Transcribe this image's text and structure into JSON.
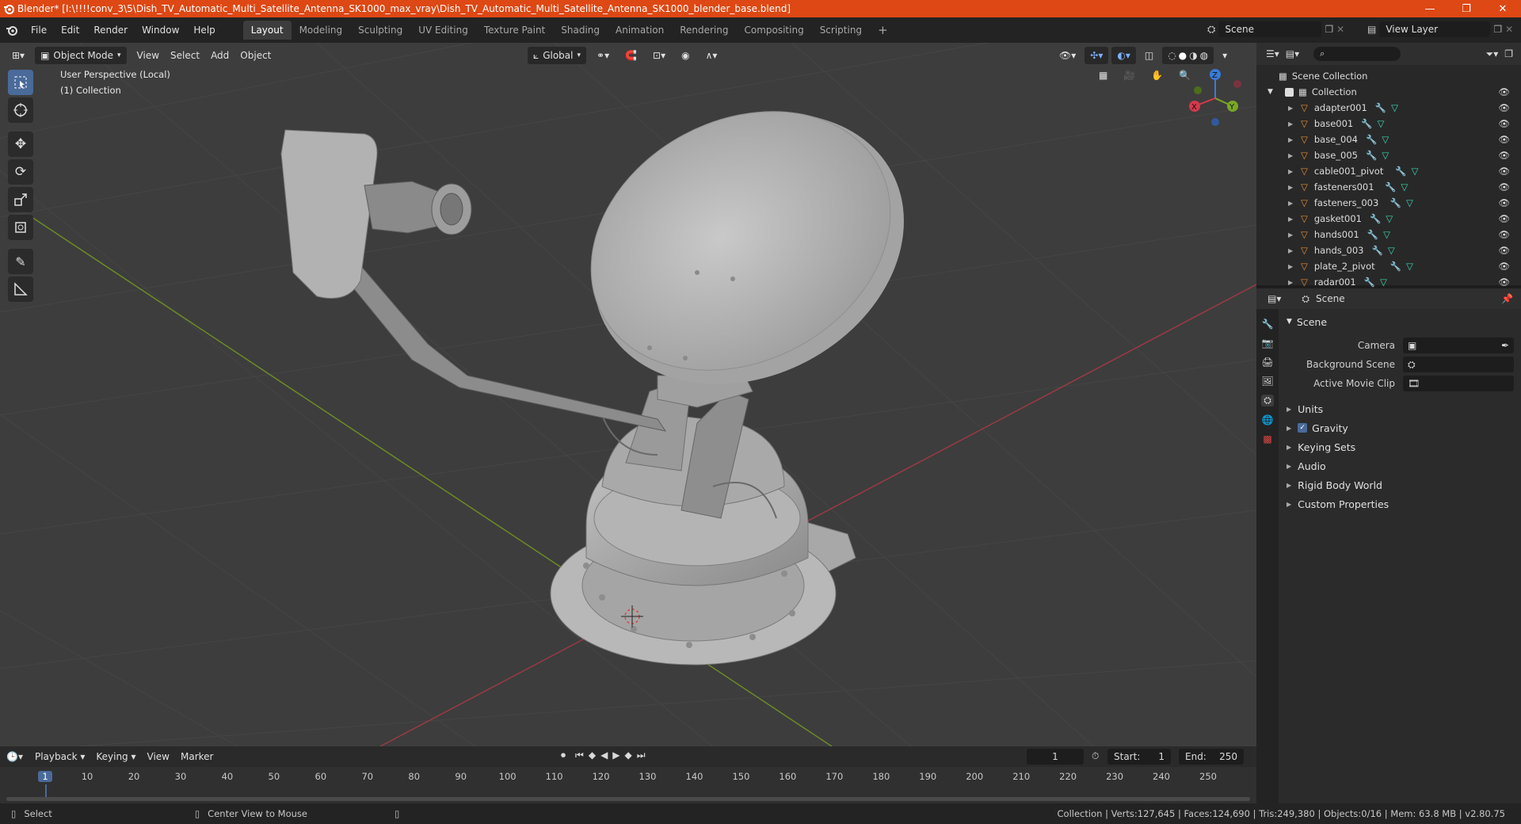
{
  "window": {
    "title": "Blender* [I:\\!!!!conv_3\\5\\Dish_TV_Automatic_Multi_Satellite_Antenna_SK1000_max_vray\\Dish_TV_Automatic_Multi_Satellite_Antenna_SK1000_blender_base.blend]",
    "controls": [
      "—",
      "❐",
      "✕"
    ]
  },
  "menubar": {
    "menus": [
      "File",
      "Edit",
      "Render",
      "Window",
      "Help"
    ],
    "workspaces": [
      "Layout",
      "Modeling",
      "Sculpting",
      "UV Editing",
      "Texture Paint",
      "Shading",
      "Animation",
      "Rendering",
      "Compositing",
      "Scripting"
    ],
    "active_workspace": "Layout",
    "add_tab": "+",
    "scene": "Scene",
    "view_layer": "View Layer"
  },
  "viewport": {
    "mode": "Object Mode",
    "menus": [
      "View",
      "Select",
      "Add",
      "Object"
    ],
    "transform_orientation": "Global",
    "overlay_text": [
      "User Perspective (Local)",
      "(1) Collection"
    ],
    "gizmo_axes": [
      "Z",
      "Y",
      "X"
    ]
  },
  "outliner": {
    "search_placeholder": "",
    "root": "Scene Collection",
    "collection": "Collection",
    "items": [
      "adapter001",
      "base001",
      "base_004",
      "base_005",
      "cable001_pivot",
      "fasteners001",
      "fasteners_003",
      "gasket001",
      "hands001",
      "hands_003",
      "plate_2_pivot",
      "radar001"
    ]
  },
  "properties": {
    "context": "Scene",
    "panel_title": "Scene",
    "fields": [
      {
        "label": "Camera",
        "value": ""
      },
      {
        "label": "Background Scene",
        "value": ""
      },
      {
        "label": "Active Movie Clip",
        "value": ""
      }
    ],
    "sections": [
      "Units",
      "Gravity",
      "Keying Sets",
      "Audio",
      "Rigid Body World",
      "Custom Properties"
    ],
    "gravity_checked": true
  },
  "timeline": {
    "menus": [
      "Playback",
      "Keying",
      "View",
      "Marker"
    ],
    "current_frame": "1",
    "start_label": "Start:",
    "start": "1",
    "end_label": "End:",
    "end": "250",
    "ticks": [
      "1",
      "10",
      "20",
      "30",
      "40",
      "50",
      "60",
      "70",
      "80",
      "90",
      "100",
      "110",
      "120",
      "130",
      "140",
      "150",
      "160",
      "170",
      "180",
      "190",
      "200",
      "210",
      "220",
      "230",
      "240",
      "250"
    ]
  },
  "statusbar": {
    "left": "Select",
    "middle": "Center View to Mouse",
    "right": "Collection | Verts:127,645 | Faces:124,690 | Tris:249,380 | Objects:0/16 | Mem: 63.8 MB | v2.80.75"
  },
  "colors": {
    "title_bar": "#dd4814",
    "accent": "#4a6a9a",
    "object_icon": "#e88b34",
    "mesh_icon": "#3dd9b0",
    "modifier_icon": "#6ea3e8"
  }
}
